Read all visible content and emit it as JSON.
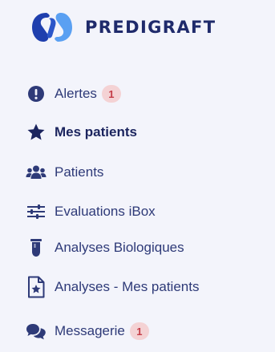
{
  "brand": {
    "name": "PREDIGRAFT",
    "logo_colors": [
      "#1f3fae",
      "#5aa0f2"
    ]
  },
  "colors": {
    "text": "#2e3a78",
    "active_text": "#1b245e",
    "badge_bg": "#f4d2d4",
    "badge_text": "#c43d48",
    "background": "#f3f4fb"
  },
  "nav": {
    "items": [
      {
        "label": "Alertes",
        "icon": "exclamation-circle-icon",
        "badge": "1"
      },
      {
        "label": "Mes patients",
        "icon": "star-icon",
        "active": true
      },
      {
        "label": "Patients",
        "icon": "users-icon"
      },
      {
        "label": "Evaluations iBox",
        "icon": "sliders-icon"
      },
      {
        "label": "Analyses Biologiques",
        "icon": "test-tube-icon"
      },
      {
        "label": "Analyses - Mes patients",
        "icon": "star-document-icon"
      },
      {
        "label": "Messagerie",
        "icon": "chat-bubbles-icon",
        "badge": "1"
      }
    ]
  }
}
